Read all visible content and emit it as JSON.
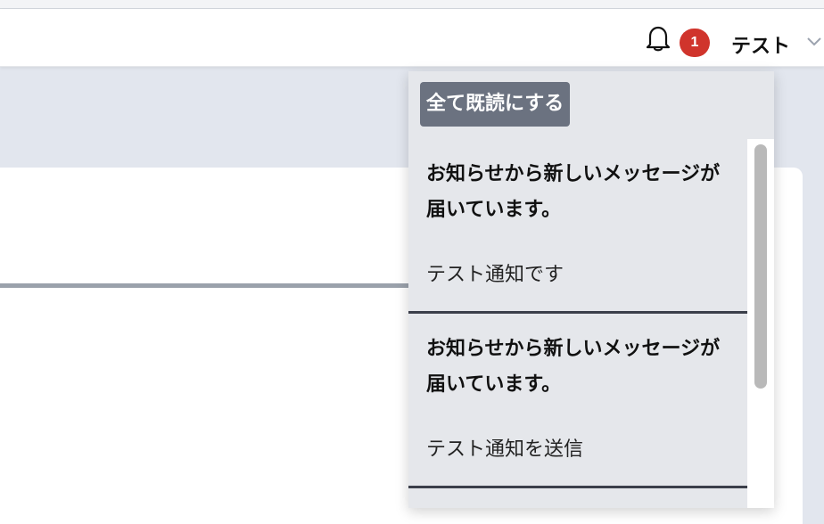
{
  "header": {
    "notification_count": "1",
    "user_name": "テスト"
  },
  "dropdown": {
    "mark_all_read_label": "全て既読にする",
    "notifications": [
      {
        "title": "お知らせから新しいメッセージが届いています。",
        "body": "テスト通知です"
      },
      {
        "title": "お知らせから新しいメッセージが届いています。",
        "body": "テスト通知を送信"
      }
    ]
  },
  "icons": {
    "bell": "bell-icon",
    "user_menu": "chevron-down-icon"
  },
  "colors": {
    "badge": "#d0342c",
    "mark_all_button": "#6b7280",
    "dropdown_background": "#e5e7eb",
    "page_background": "#e2e6ee"
  }
}
